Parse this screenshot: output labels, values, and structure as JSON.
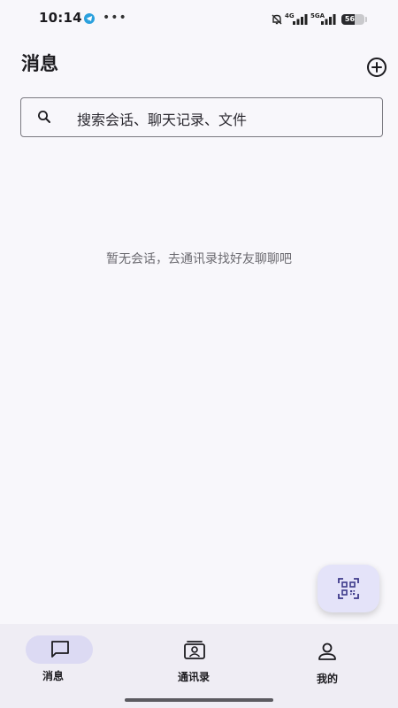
{
  "status_bar": {
    "time": "10:14",
    "network_1": "4G",
    "network_2": "5GA",
    "battery": "56",
    "battery_level": 0.56
  },
  "header": {
    "title": "消息"
  },
  "search": {
    "placeholder": "搜索会话、聊天记录、文件"
  },
  "main": {
    "empty_hint": "暂无会话，去通讯录找好友聊聊吧"
  },
  "bottom_nav": {
    "items": [
      {
        "label": "消息",
        "icon": "chat-bubble-icon",
        "active": true
      },
      {
        "label": "通讯录",
        "icon": "contacts-icon",
        "active": false
      },
      {
        "label": "我的",
        "icon": "person-icon",
        "active": false
      }
    ]
  },
  "colors": {
    "background": "#f8f7fb",
    "nav_background": "#efedf4",
    "active_pill": "#dcdaf3",
    "fab": "#e4e3f9",
    "telegram": "#2aa0dd"
  },
  "icons": {
    "add": "plus-circle-icon",
    "search": "search-icon",
    "scan": "qr-scan-icon"
  }
}
